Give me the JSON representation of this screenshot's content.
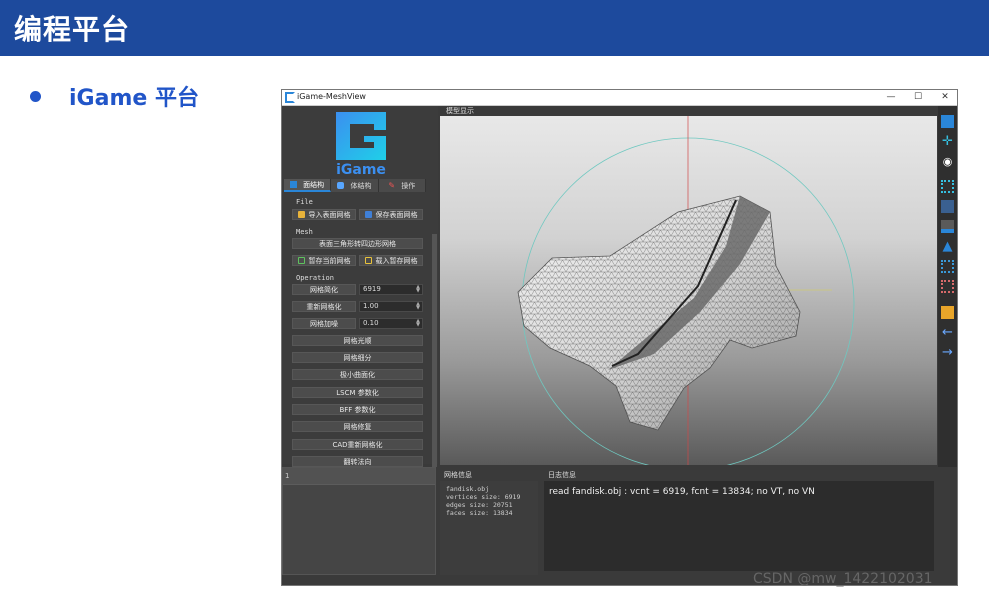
{
  "slide": {
    "title": "编程平台",
    "bullet": "iGame 平台"
  },
  "window": {
    "title": "iGame-MeshView",
    "minimize": "—",
    "maximize": "☐",
    "close": "✕"
  },
  "logo": {
    "text": "iGame"
  },
  "left_panel": {
    "tabs": [
      "面结构",
      "体结构",
      "操作"
    ],
    "file_label": "File",
    "import_button": "导入表面网格",
    "save_button": "保存表面网格",
    "mesh_label": "Mesh",
    "tri2quad_button": "表面三角形转四边形网格",
    "stash_button": "暂存当前网格",
    "load_stash_button": "载入暂存网格",
    "operation_label": "Operation",
    "simplify_button": "网格简化",
    "simplify_value": "6919",
    "remesh_button": "重新网格化",
    "remesh_value": "1.00",
    "noise_button": "网格加噪",
    "noise_value": "0.10",
    "ops": [
      "网格光顺",
      "网格细分",
      "极小曲面化",
      "LSCM 参数化",
      "BFF 参数化",
      "网格修复",
      "CAD重新网格化",
      "翻转法向"
    ]
  },
  "viewport": {
    "label": "模型显示"
  },
  "bottom": {
    "mesh_info_title": "网格信息",
    "mesh_info_lines": [
      "fandisk.obj",
      "vertices size: 6919",
      "edges size: 20751",
      "faces size: 13834"
    ],
    "log_title": "日志信息",
    "log_text": "read fandisk.obj : vcnt = 6919,  fcnt = 13834;  no VT, no VN",
    "left_strip": "1"
  },
  "toolbar_icons": [
    "grid-icon",
    "move-icon",
    "eye-icon",
    "vertices-icon",
    "faces-icon",
    "layer-icon",
    "cone-icon",
    "points-icon",
    "cluster-icon",
    "box-icon",
    "arrow-left-icon",
    "arrow-right-icon"
  ],
  "colors": {
    "banner": "#1d4a9d",
    "accent": "#2155c8",
    "ui_blue": "#2a86d8"
  },
  "watermark": "CSDN @mw_1422102031"
}
